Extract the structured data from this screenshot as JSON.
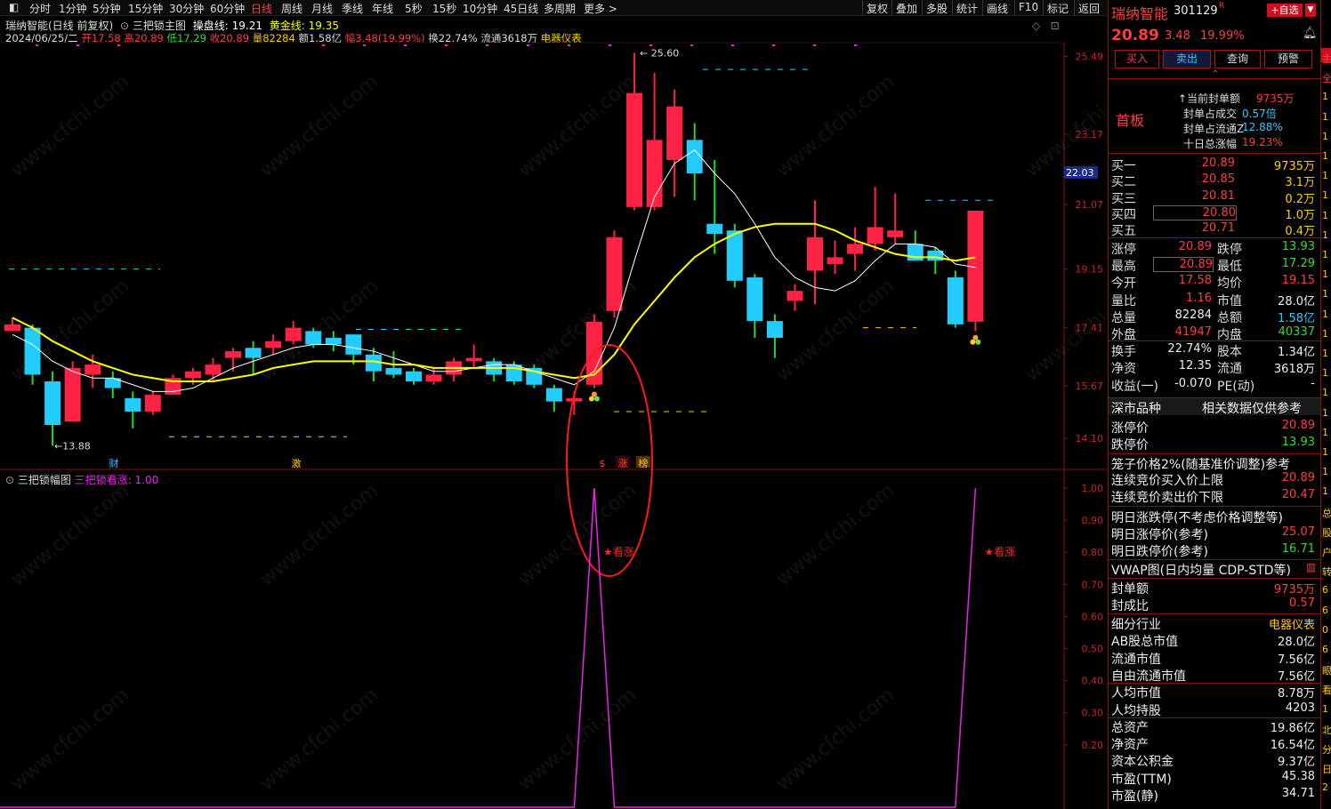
{
  "toolbar": {
    "periods": [
      "分时",
      "1分钟",
      "5分钟",
      "15分钟",
      "30分钟",
      "60分钟",
      "日线",
      "周线",
      "月线",
      "季线",
      "年线",
      "5秒",
      "15秒",
      "10分钟",
      "45日线",
      "多周期",
      "更多 >"
    ],
    "active_period": "日线",
    "right_tools": [
      "复权",
      "叠加",
      "多股",
      "统计",
      "画线",
      "F10",
      "标记",
      "返回"
    ]
  },
  "header": {
    "stock_title": "瑞纳智能(日线 前复权)",
    "indicator_name": "三把锁主图",
    "operate_label": "操盘线: 19.21",
    "golden_label": "黄金线: 19.35",
    "date": "2024/06/25/二",
    "open": "开17.58",
    "high": "高20.89",
    "low": "低17.29",
    "close": "收20.89",
    "volume": "量82284",
    "amount": "额1.58亿",
    "change": "幅3.48(19.99%)",
    "turnover": "换22.74%",
    "float": "流通3618万",
    "industry": "电器仪表"
  },
  "main_chart": {
    "price_axis": [
      "25.49",
      "23.17",
      "21.07",
      "19.15",
      "17.41",
      "15.67",
      "14.10"
    ],
    "current_price_tag": "22.03",
    "high_label": "25.60",
    "low_label": "13.88",
    "bottom_markers": [
      "财",
      "激",
      "$",
      "涨",
      "榜"
    ]
  },
  "sub_chart": {
    "title": "三把锁幅图",
    "value_label": "三把锁看涨: 1.00",
    "axis": [
      "1.00",
      "0.90",
      "0.80",
      "0.70",
      "0.60",
      "0.50",
      "0.40",
      "0.30",
      "0.20"
    ],
    "signal_text": "★看涨"
  },
  "chart_data": {
    "type": "candlestick",
    "candles": [
      {
        "o": 17.3,
        "c": 17.5,
        "h": 17.7,
        "l": 17.3
      },
      {
        "o": 17.4,
        "c": 16.0,
        "h": 17.5,
        "l": 15.7
      },
      {
        "o": 15.8,
        "c": 14.5,
        "h": 16.1,
        "l": 13.88
      },
      {
        "o": 14.6,
        "c": 16.2,
        "h": 16.4,
        "l": 14.6
      },
      {
        "o": 16.0,
        "c": 16.3,
        "h": 16.6,
        "l": 15.6
      },
      {
        "o": 15.9,
        "c": 15.6,
        "h": 16.1,
        "l": 15.3
      },
      {
        "o": 15.3,
        "c": 14.9,
        "h": 15.5,
        "l": 14.4
      },
      {
        "o": 14.9,
        "c": 15.4,
        "h": 15.5,
        "l": 14.8
      },
      {
        "o": 15.4,
        "c": 15.9,
        "h": 16.0,
        "l": 15.4
      },
      {
        "o": 15.9,
        "c": 16.1,
        "h": 16.2,
        "l": 15.7
      },
      {
        "o": 16.0,
        "c": 16.3,
        "h": 16.5,
        "l": 15.8
      },
      {
        "o": 16.5,
        "c": 16.7,
        "h": 16.8,
        "l": 16.1
      },
      {
        "o": 16.8,
        "c": 16.5,
        "h": 17.0,
        "l": 16.0
      },
      {
        "o": 16.8,
        "c": 17.0,
        "h": 17.2,
        "l": 16.6
      },
      {
        "o": 17.0,
        "c": 17.4,
        "h": 17.6,
        "l": 16.9
      },
      {
        "o": 17.3,
        "c": 16.9,
        "h": 17.4,
        "l": 16.8
      },
      {
        "o": 17.1,
        "c": 16.9,
        "h": 17.3,
        "l": 16.7
      },
      {
        "o": 17.2,
        "c": 16.6,
        "h": 17.2,
        "l": 16.3
      },
      {
        "o": 16.6,
        "c": 16.1,
        "h": 16.8,
        "l": 15.8
      },
      {
        "o": 16.2,
        "c": 16.0,
        "h": 16.7,
        "l": 15.9
      },
      {
        "o": 16.1,
        "c": 15.8,
        "h": 16.2,
        "l": 15.7
      },
      {
        "o": 15.8,
        "c": 16.0,
        "h": 16.2,
        "l": 15.7
      },
      {
        "o": 16.0,
        "c": 16.4,
        "h": 16.5,
        "l": 15.8
      },
      {
        "o": 16.4,
        "c": 16.5,
        "h": 16.9,
        "l": 16.2
      },
      {
        "o": 16.4,
        "c": 16.0,
        "h": 16.5,
        "l": 15.8
      },
      {
        "o": 16.3,
        "c": 15.8,
        "h": 16.4,
        "l": 15.7
      },
      {
        "o": 16.2,
        "c": 15.7,
        "h": 16.3,
        "l": 15.6
      },
      {
        "o": 15.6,
        "c": 15.2,
        "h": 15.7,
        "l": 14.9
      },
      {
        "o": 15.2,
        "c": 15.3,
        "h": 15.5,
        "l": 14.8
      },
      {
        "o": 15.7,
        "c": 17.58,
        "h": 17.8,
        "l": 15.6
      },
      {
        "o": 17.9,
        "c": 20.1,
        "h": 20.3,
        "l": 17.7
      },
      {
        "o": 21.0,
        "c": 24.4,
        "h": 25.6,
        "l": 20.9
      },
      {
        "o": 21.0,
        "c": 23.0,
        "h": 25.0,
        "l": 20.9
      },
      {
        "o": 22.4,
        "c": 24.0,
        "h": 24.5,
        "l": 21.3
      },
      {
        "o": 23.0,
        "c": 22.0,
        "h": 23.5,
        "l": 21.2
      },
      {
        "o": 20.5,
        "c": 20.2,
        "h": 22.4,
        "l": 19.6
      },
      {
        "o": 20.3,
        "c": 18.8,
        "h": 20.5,
        "l": 18.6
      },
      {
        "o": 18.9,
        "c": 17.6,
        "h": 19.0,
        "l": 17.1
      },
      {
        "o": 17.6,
        "c": 17.1,
        "h": 17.8,
        "l": 16.5
      },
      {
        "o": 18.2,
        "c": 18.5,
        "h": 18.7,
        "l": 17.9
      },
      {
        "o": 19.1,
        "c": 20.1,
        "h": 21.2,
        "l": 18.1
      },
      {
        "o": 19.3,
        "c": 19.5,
        "h": 20.0,
        "l": 19.0
      },
      {
        "o": 19.6,
        "c": 19.9,
        "h": 20.4,
        "l": 19.1
      },
      {
        "o": 19.9,
        "c": 20.4,
        "h": 21.6,
        "l": 19.7
      },
      {
        "o": 20.1,
        "c": 20.3,
        "h": 21.4,
        "l": 19.9
      },
      {
        "o": 19.9,
        "c": 19.4,
        "h": 20.3,
        "l": 19.4
      },
      {
        "o": 19.7,
        "c": 19.4,
        "h": 19.8,
        "l": 19.0
      },
      {
        "o": 18.9,
        "c": 17.5,
        "h": 19.1,
        "l": 17.4
      },
      {
        "o": 17.58,
        "c": 20.89,
        "h": 20.89,
        "l": 17.29
      }
    ],
    "white_line": [
      17.2,
      16.9,
      16.4,
      16.1,
      15.9,
      15.9,
      15.7,
      15.5,
      15.5,
      15.6,
      15.9,
      16.2,
      16.4,
      16.6,
      16.8,
      16.9,
      16.9,
      16.8,
      16.7,
      16.5,
      16.3,
      16.1,
      16.1,
      16.2,
      16.3,
      16.3,
      16.1,
      15.9,
      15.7,
      16.1,
      17.4,
      19.4,
      21.3,
      22.3,
      22.7,
      22.0,
      21.4,
      20.5,
      19.5,
      18.9,
      18.6,
      18.5,
      18.8,
      19.4,
      19.9,
      19.9,
      19.8,
      19.3,
      19.2
    ],
    "yellow_line": [
      17.7,
      17.4,
      17.0,
      16.7,
      16.4,
      16.2,
      16.0,
      15.9,
      15.8,
      15.8,
      15.8,
      15.9,
      16.0,
      16.2,
      16.3,
      16.4,
      16.4,
      16.4,
      16.4,
      16.3,
      16.3,
      16.2,
      16.2,
      16.2,
      16.2,
      16.2,
      16.1,
      16.0,
      15.9,
      16.0,
      16.6,
      17.5,
      18.2,
      18.9,
      19.5,
      19.9,
      20.2,
      20.4,
      20.5,
      20.5,
      20.5,
      20.3,
      20.0,
      19.8,
      19.6,
      19.5,
      19.5,
      19.4,
      19.5
    ],
    "signal": [
      0,
      0,
      0,
      0,
      0,
      0,
      0,
      0,
      0,
      0,
      0,
      0,
      0,
      0,
      0,
      0,
      0,
      0,
      0,
      0,
      0,
      0,
      0,
      0,
      0,
      0,
      0,
      0,
      0,
      1,
      0,
      0,
      0,
      0,
      0,
      0,
      0,
      0,
      0,
      0,
      0,
      0,
      0,
      0,
      0,
      0,
      0,
      0,
      1
    ],
    "price_range": [
      13.6,
      25.9
    ]
  },
  "stock_panel": {
    "name": "瑞纳智能",
    "code": "301129",
    "add_watch": "+自选",
    "price": "20.89",
    "change": "3.48",
    "change_pct": "19.99%",
    "buttons": [
      "买入",
      "卖出",
      "查询",
      "预警"
    ],
    "board": "首板",
    "seal_info": [
      {
        "label": "当前封单额",
        "value": "9735万"
      },
      {
        "label": "封单占成交",
        "value": "0.57倍"
      },
      {
        "label": "封单占流通Z",
        "value": "12.88%"
      },
      {
        "label": "十日总涨幅",
        "value": "19.23%"
      }
    ],
    "bids": [
      {
        "label": "买一",
        "price": "20.89",
        "vol": "9735万"
      },
      {
        "label": "买二",
        "price": "20.85",
        "vol": "3.1万"
      },
      {
        "label": "买三",
        "price": "20.81",
        "vol": "0.2万"
      },
      {
        "label": "买四",
        "price": "20.80",
        "vol": "1.0万"
      },
      {
        "label": "买五",
        "price": "20.71",
        "vol": "0.4万"
      }
    ],
    "stats": [
      {
        "l1": "涨停",
        "v1": "20.89",
        "l2": "跌停",
        "v2": "13.93",
        "c1": "#ff3d3d",
        "c2": "#33dd33"
      },
      {
        "l1": "最高",
        "v1": "20.89",
        "l2": "最低",
        "v2": "17.29",
        "c1": "#ff3d3d",
        "c2": "#33dd33"
      },
      {
        "l1": "今开",
        "v1": "17.58",
        "l2": "均价",
        "v2": "19.15",
        "c1": "#ff3d3d",
        "c2": "#ff3d3d"
      },
      {
        "l1": "量比",
        "v1": "1.16",
        "l2": "市值",
        "v2": "28.0亿",
        "c1": "#ff3d3d",
        "c2": "#eeeeee"
      },
      {
        "l1": "总量",
        "v1": "82284",
        "l2": "总额",
        "v2": "1.58亿",
        "c1": "#eeeeee",
        "c2": "#35c6ff"
      },
      {
        "l1": "外盘",
        "v1": "41947",
        "l2": "内盘",
        "v2": "40337",
        "c1": "#ff3d3d",
        "c2": "#33dd33"
      },
      {
        "l1": "换手",
        "v1": "22.74%",
        "l2": "股本",
        "v2": "1.34亿",
        "c1": "#eeeeee",
        "c2": "#eeeeee"
      },
      {
        "l1": "净资",
        "v1": "12.35",
        "l2": "流通",
        "v2": "3618万",
        "c1": "#eeeeee",
        "c2": "#eeeeee"
      },
      {
        "l1": "收益(一)",
        "v1": "-0.070",
        "l2": "PE(动)",
        "v2": "-",
        "c1": "#eeeeee",
        "c2": "#eeeeee"
      }
    ],
    "section1_left": "深市品种",
    "section1_right": "相关数据仅供参考",
    "limit_rows": [
      {
        "label": "涨停价",
        "value": "20.89",
        "color": "#ff3d3d"
      },
      {
        "label": "跌停价",
        "value": "13.93",
        "color": "#33dd33"
      }
    ],
    "cage_title": "笼子价格2%(随基准价调整)参考",
    "cage_rows": [
      {
        "label": "连续竞价买入价上限",
        "value": "20.89",
        "color": "#ff3d3d"
      },
      {
        "label": "连续竞价卖出价下限",
        "value": "20.47",
        "color": "#ff3d3d"
      }
    ],
    "tomorrow_title": "明日涨跌停(不考虑价格调整等)",
    "tomorrow_rows": [
      {
        "label": "明日涨停价(参考)",
        "value": "25.07",
        "color": "#ff3d3d"
      },
      {
        "label": "明日跌停价(参考)",
        "value": "16.71",
        "color": "#33dd33"
      }
    ],
    "vwap_title": "VWAP图(日内均量 CDP-STD等)",
    "seal_rows": [
      {
        "label": "封单额",
        "value": "9735万",
        "color": "#ff3d3d"
      },
      {
        "label": "封成比",
        "value": "0.57",
        "color": "#ff3d3d"
      }
    ],
    "fund_rows": [
      {
        "label": "细分行业",
        "value": "电器仪表",
        "color": "#ffcc00"
      },
      {
        "label": "AB股总市值",
        "value": "28.0亿",
        "color": "#eeeeee"
      },
      {
        "label": "流通市值",
        "value": "7.56亿",
        "color": "#eeeeee"
      },
      {
        "label": "自由流通市值",
        "value": "7.56亿",
        "color": "#eeeeee"
      },
      {
        "label": "人均市值",
        "value": "8.78万",
        "color": "#eeeeee"
      },
      {
        "label": "人均持股",
        "value": "4203",
        "color": "#eeeeee"
      },
      {
        "label": "总资产",
        "value": "19.86亿",
        "color": "#eeeeee"
      },
      {
        "label": "净资产",
        "value": "16.54亿",
        "color": "#eeeeee"
      },
      {
        "label": "资本公积金",
        "value": "9.37亿",
        "color": "#eeeeee"
      },
      {
        "label": "市盈(TTM)",
        "value": "45.38",
        "color": "#eeeeee"
      },
      {
        "label": "市盈(静)",
        "value": "34.71",
        "color": "#eeeeee"
      }
    ]
  },
  "watermark": "www.cfchi.com",
  "colors": {
    "up": "#ff2244",
    "down": "#22ccff",
    "ma_white": "#ffffff",
    "ma_yellow": "#ffff00",
    "signal": "#ee22ee",
    "accent": "#ff3d3d"
  }
}
